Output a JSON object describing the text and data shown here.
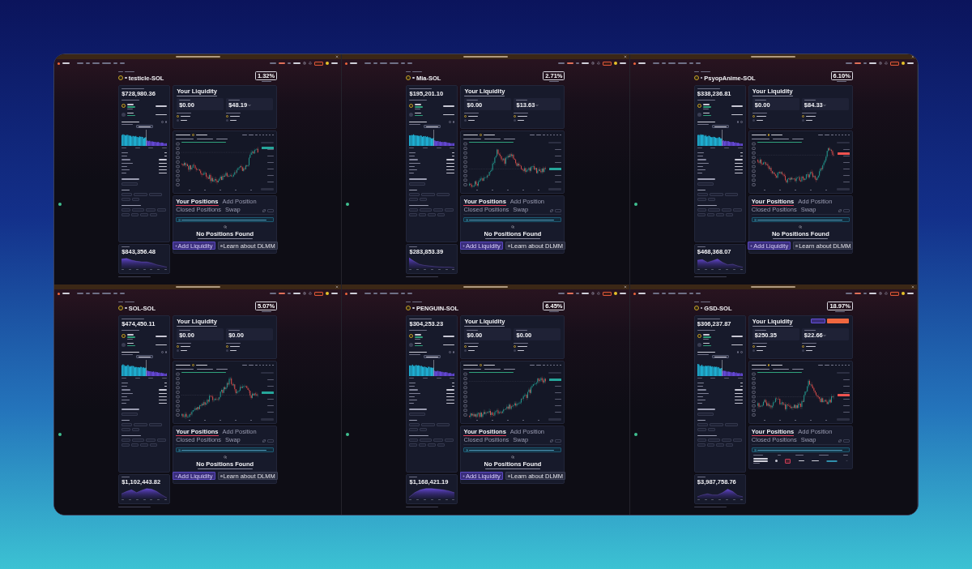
{
  "panels": [
    {
      "pair": "testicle-SOL",
      "apr": "1.32%",
      "headline_value": "$728,980.36",
      "liquidity": {
        "title": "Your Liquidity",
        "stats": [
          {
            "value": "$0.00",
            "dropdown": false
          },
          {
            "value": "$48.19",
            "dropdown": true
          }
        ]
      },
      "chart": {
        "kind": "valley",
        "falling": false
      },
      "tabs": [
        {
          "label": "Your Positions",
          "selected": true
        },
        {
          "label": "Add Position",
          "selected": false
        },
        {
          "label": "Closed Positions",
          "selected": false
        },
        {
          "label": "Swap",
          "selected": false
        }
      ],
      "positions": {
        "kind": "empty",
        "title": "No Positions Found",
        "buttons": [
          {
            "label": "Add Liquidity",
            "kind": "primary"
          },
          {
            "label": "Learn about DLMM",
            "kind": "secondary"
          }
        ]
      },
      "lower_card_value": "$843,356.48"
    },
    {
      "pair": "Mia-SOL",
      "apr": "2.71%",
      "headline_value": "$195,201.10",
      "liquidity": {
        "title": "Your Liquidity",
        "stats": [
          {
            "value": "$0.00",
            "dropdown": false
          },
          {
            "value": "$13.63",
            "dropdown": true
          }
        ]
      },
      "chart": {
        "kind": "peak",
        "falling": false
      },
      "tabs": [
        {
          "label": "Your Positions",
          "selected": true
        },
        {
          "label": "Add Position",
          "selected": false
        },
        {
          "label": "Closed Positions",
          "selected": false
        },
        {
          "label": "Swap",
          "selected": false
        }
      ],
      "positions": {
        "kind": "empty",
        "title": "No Positions Found",
        "buttons": [
          {
            "label": "Add Liquidity",
            "kind": "primary"
          },
          {
            "label": "Learn about DLMM",
            "kind": "secondary"
          }
        ]
      },
      "lower_card_value": "$283,853.39"
    },
    {
      "pair": "PsyopAnime-SOL",
      "apr": "6.10%",
      "headline_value": "$338,236.81",
      "liquidity": {
        "title": "Your Liquidity",
        "stats": [
          {
            "value": "$0.00",
            "dropdown": false
          },
          {
            "value": "$84.33",
            "dropdown": true
          }
        ]
      },
      "chart": {
        "kind": "drop-rise",
        "falling": true
      },
      "tabs": [
        {
          "label": "Your Positions",
          "selected": true
        },
        {
          "label": "Add Position",
          "selected": false
        },
        {
          "label": "Closed Positions",
          "selected": false
        },
        {
          "label": "Swap",
          "selected": false
        }
      ],
      "positions": {
        "kind": "empty",
        "title": "No Positions Found",
        "buttons": [
          {
            "label": "Add Liquidity",
            "kind": "primary"
          },
          {
            "label": "Learn about DLMM",
            "kind": "secondary"
          }
        ]
      },
      "lower_card_value": "$468,368.07"
    },
    {
      "pair": "SOL-SOL",
      "apr": "5.07%",
      "headline_value": "$474,450.11",
      "liquidity": {
        "title": "Your Liquidity",
        "stats": [
          {
            "value": "$0.00",
            "dropdown": false
          },
          {
            "value": "$0.00",
            "dropdown": false
          }
        ]
      },
      "chart": {
        "kind": "hump",
        "falling": false
      },
      "tabs": [
        {
          "label": "Your Positions",
          "selected": true
        },
        {
          "label": "Add Position",
          "selected": false
        },
        {
          "label": "Closed Positions",
          "selected": false
        },
        {
          "label": "Swap",
          "selected": false
        }
      ],
      "positions": {
        "kind": "empty",
        "title": "No Positions Found",
        "buttons": [
          {
            "label": "Add Liquidity",
            "kind": "primary"
          },
          {
            "label": "Learn about DLMM",
            "kind": "secondary"
          }
        ]
      },
      "lower_card_value": "$1,102,443.82"
    },
    {
      "pair": "PENGUIN-SOL",
      "apr": "6.45%",
      "headline_value": "$304,253.23",
      "liquidity": {
        "title": "Your Liquidity",
        "stats": [
          {
            "value": "$0.00",
            "dropdown": false
          },
          {
            "value": "$0.00",
            "dropdown": false
          }
        ]
      },
      "chart": {
        "kind": "rise",
        "falling": false
      },
      "tabs": [
        {
          "label": "Your Positions",
          "selected": true
        },
        {
          "label": "Add Position",
          "selected": false
        },
        {
          "label": "Closed Positions",
          "selected": false
        },
        {
          "label": "Swap",
          "selected": false
        }
      ],
      "positions": {
        "kind": "empty",
        "title": "No Positions Found",
        "buttons": [
          {
            "label": "Add Liquidity",
            "kind": "primary"
          },
          {
            "label": "Learn about DLMM",
            "kind": "secondary"
          }
        ]
      },
      "lower_card_value": "$1,168,421.19"
    },
    {
      "pair": "GSD-SOL",
      "apr": "18.97%",
      "headline_value": "$306,237.87",
      "liquidity": {
        "title": "Your Liquidity",
        "actions": [
          {
            "kind": "primary"
          },
          {
            "kind": "danger"
          }
        ],
        "stats": [
          {
            "value": "$250.35",
            "dropdown": false
          },
          {
            "value": "$22.66",
            "dropdown": true
          }
        ]
      },
      "chart": {
        "kind": "spike",
        "falling": true
      },
      "tabs": [
        {
          "label": "Your Positions",
          "selected": true
        },
        {
          "label": "Add Position",
          "selected": false
        },
        {
          "label": "Closed Positions",
          "selected": false
        },
        {
          "label": "Swap",
          "selected": false
        }
      ],
      "positions": {
        "kind": "table"
      },
      "lower_card_value": "$3,987,758.76"
    }
  ]
}
